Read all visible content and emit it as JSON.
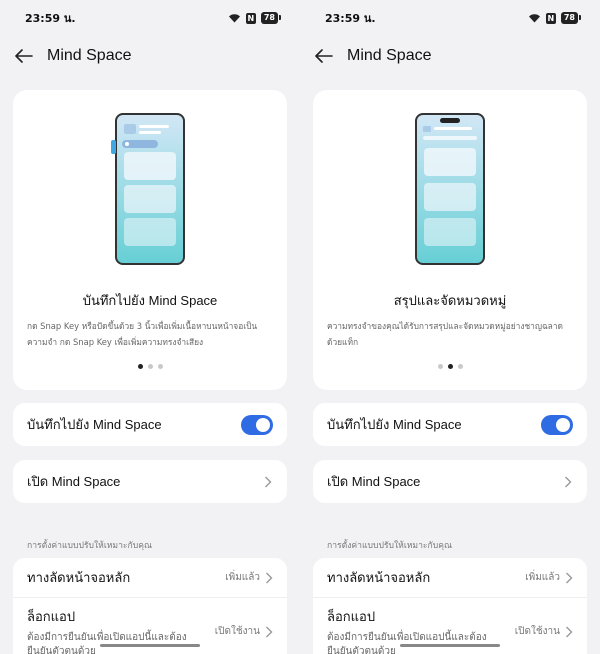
{
  "screens": [
    {
      "status": {
        "time": "23:59 น.",
        "battery": "78"
      },
      "appbar": {
        "title": "Mind Space"
      },
      "hero": {
        "title": "บันทึกไปยัง Mind Space",
        "desc": "กด Snap Key หรือปัดขึ้นด้วย 3 นิ้วเพื่อเพิ่มเนื้อหาบนหน้าจอเป็นความจำ กด Snap Key เพื่อเพิ่มความทรงจำเสียง",
        "active_dot": 0
      },
      "toggle_row": {
        "label": "บันทึกไปยัง Mind Space",
        "on": true
      },
      "open_row": {
        "label": "เปิด Mind Space"
      },
      "section_label": "การตั้งค่าแบบปรับให้เหมาะกับคุณ",
      "shortcut": {
        "label": "ทางลัดหน้าจอหลัก",
        "value": "เพิ่มแล้ว"
      },
      "lock": {
        "label": "ล็อกแอป",
        "sub": "ต้องมีการยืนยันเพื่อเปิดแอปนี้และต้องยืนยันตัวตนด้วย",
        "value": "เปิดใช้งาน"
      }
    },
    {
      "status": {
        "time": "23:59 น.",
        "battery": "78"
      },
      "appbar": {
        "title": "Mind Space"
      },
      "hero": {
        "title": "สรุปและจัดหมวดหมู่",
        "desc": "ความทรงจำของคุณได้รับการสรุปและจัดหมวดหมู่อย่างชาญฉลาดด้วยแท็ก",
        "active_dot": 1
      },
      "toggle_row": {
        "label": "บันทึกไปยัง Mind Space",
        "on": true
      },
      "open_row": {
        "label": "เปิด Mind Space"
      },
      "section_label": "การตั้งค่าแบบปรับให้เหมาะกับคุณ",
      "shortcut": {
        "label": "ทางลัดหน้าจอหลัก",
        "value": "เพิ่มแล้ว"
      },
      "lock": {
        "label": "ล็อกแอป",
        "sub": "ต้องมีการยืนยันเพื่อเปิดแอปนี้และต้องยืนยันตัวตนด้วย",
        "value": "เปิดใช้งาน"
      }
    }
  ],
  "colors": {
    "accent": "#2f6be3",
    "illustration_top": "#cfe4f4",
    "illustration_bottom": "#6ccfd6"
  },
  "icons": [
    "wifi-icon",
    "nfc-icon",
    "battery-icon",
    "back-arrow-icon",
    "chevron-right-icon"
  ]
}
